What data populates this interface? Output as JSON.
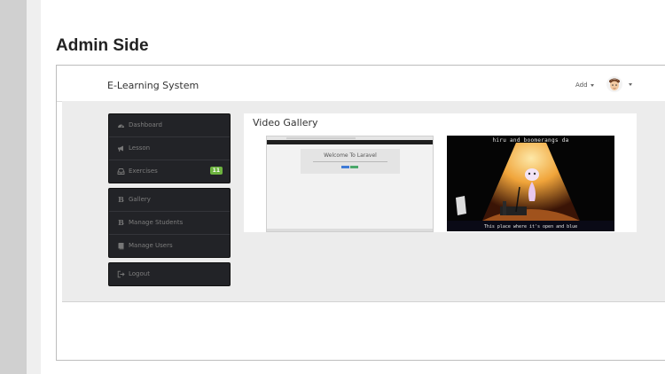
{
  "page": {
    "title": "Admin Side"
  },
  "navbar": {
    "brand": "E-Learning System",
    "add_label": "Add"
  },
  "sidebar": {
    "groups": [
      [
        {
          "label": "Dashboard",
          "icon": "dashboard-icon"
        },
        {
          "label": "Lesson",
          "icon": "megaphone-icon"
        },
        {
          "label": "Exercises",
          "icon": "inbox-icon",
          "badge": "11"
        }
      ],
      [
        {
          "label": "Gallery",
          "icon": "bold-b-icon"
        },
        {
          "label": "Manage Students",
          "icon": "bold-b-icon"
        },
        {
          "label": "Manage Users",
          "icon": "book-icon"
        }
      ],
      [
        {
          "label": "Logout",
          "icon": "logout-icon"
        }
      ]
    ]
  },
  "gallery": {
    "title": "Video Gallery",
    "videos": [
      {
        "screen_title": "Welcome To Laravel"
      },
      {
        "caption_top": "hiru and boomerangs da",
        "caption_bottom": "This place where it's open and blue"
      }
    ]
  },
  "colors": {
    "sidebar_bg": "#222327",
    "badge": "#6db33f",
    "band_bg": "#ececec"
  }
}
